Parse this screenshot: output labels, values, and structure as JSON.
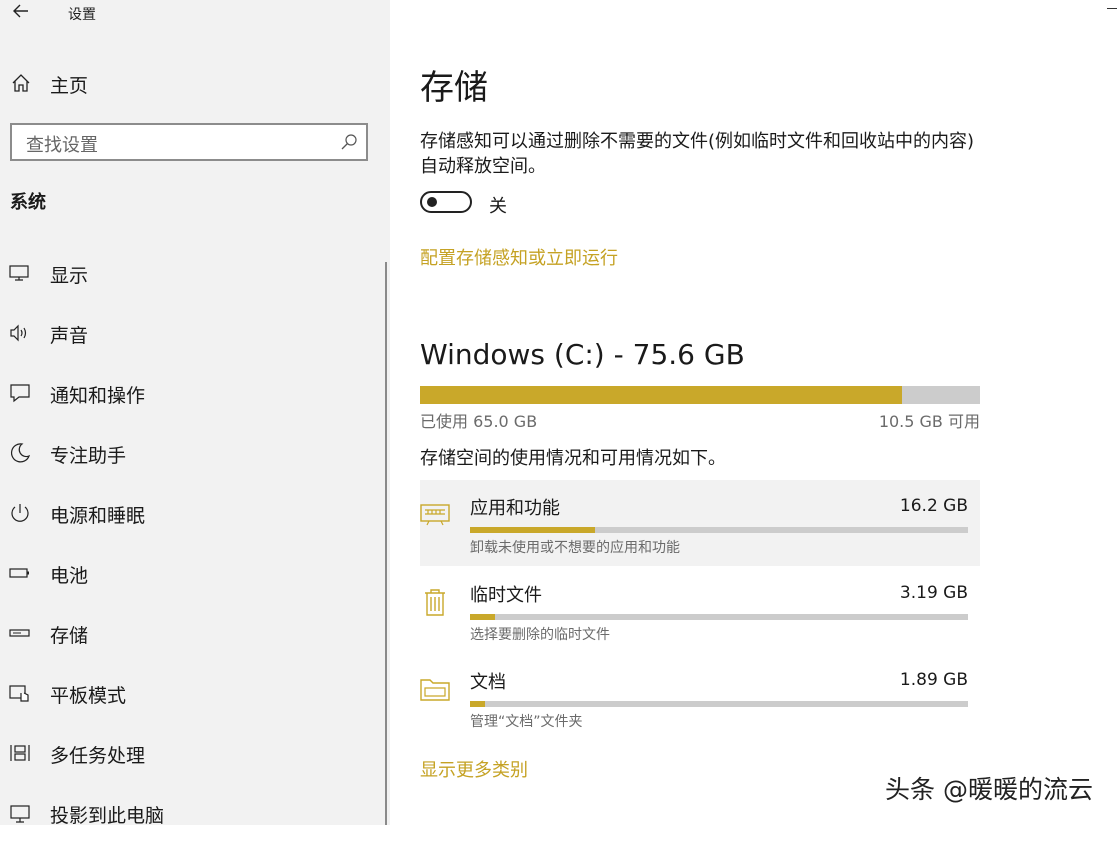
{
  "window": {
    "title": "设置",
    "back_icon": "back-arrow-icon"
  },
  "sidebar": {
    "home_label": "主页",
    "search_placeholder": "查找设置",
    "section_title": "系统",
    "items": [
      {
        "label": "显示",
        "icon": "monitor-icon"
      },
      {
        "label": "声音",
        "icon": "speaker-icon"
      },
      {
        "label": "通知和操作",
        "icon": "notification-icon"
      },
      {
        "label": "专注助手",
        "icon": "moon-icon"
      },
      {
        "label": "电源和睡眠",
        "icon": "power-icon"
      },
      {
        "label": "电池",
        "icon": "battery-icon"
      },
      {
        "label": "存储",
        "icon": "storage-icon"
      },
      {
        "label": "平板模式",
        "icon": "tablet-icon"
      },
      {
        "label": "多任务处理",
        "icon": "multitask-icon"
      },
      {
        "label": "投影到此电脑",
        "icon": "project-icon"
      }
    ]
  },
  "main": {
    "title": "存储",
    "description": "存储感知可以通过删除不需要的文件(例如临时文件和回收站中的内容)自动释放空间。",
    "storage_sense_state": "关",
    "config_link": "配置存储感知或立即运行",
    "drive": {
      "title": "Windows (C:) - 75.6 GB",
      "used_label": "已使用 65.0 GB",
      "free_label": "10.5 GB 可用",
      "used_fraction": 0.86
    },
    "usage_description": "存储空间的使用情况和可用情况如下。",
    "categories": [
      {
        "name": "应用和功能",
        "size": "16.2 GB",
        "subtitle": "卸载未使用或不想要的应用和功能",
        "fraction": 0.25,
        "icon": "apps-icon"
      },
      {
        "name": "临时文件",
        "size": "3.19 GB",
        "subtitle": "选择要删除的临时文件",
        "fraction": 0.05,
        "icon": "trash-icon"
      },
      {
        "name": "文档",
        "size": "1.89 GB",
        "subtitle": "管理“文档”文件夹",
        "fraction": 0.03,
        "icon": "folder-icon"
      }
    ],
    "show_more_link": "显示更多类别"
  },
  "watermark": "头条 @暖暖的流云",
  "colors": {
    "accent": "#c9a82a",
    "link": "#c5a224",
    "sidebar_bg": "#f2f2f2",
    "bar_bg": "#cccccc"
  }
}
